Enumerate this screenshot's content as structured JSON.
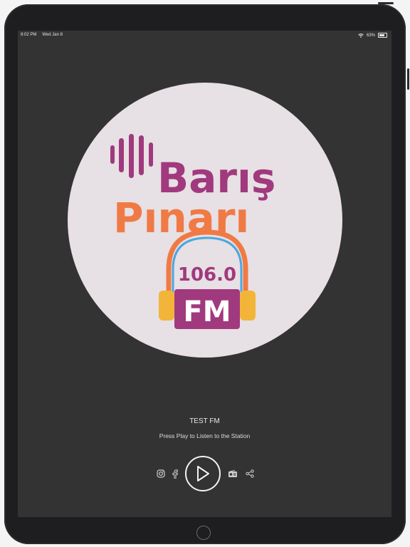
{
  "status_bar": {
    "time": "8:02 PM",
    "date": "Wed Jan 8",
    "battery": "63%",
    "icons": [
      "wifi-icon",
      "battery-icon"
    ]
  },
  "logo": {
    "line1": "Barış",
    "line2": "Pınarı",
    "frequency": "106.0",
    "band": "FM",
    "colors": {
      "purple": "#a1397e",
      "orange": "#f07a45",
      "disc": "#e7e0e4",
      "yellow": "#f2b53a"
    }
  },
  "station": {
    "name": "TEST FM",
    "subtitle": "Press Play to Listen to the Station"
  },
  "controls": {
    "icons": [
      "instagram-icon",
      "facebook-icon",
      "play-icon",
      "radio-icon",
      "share-icon"
    ]
  }
}
